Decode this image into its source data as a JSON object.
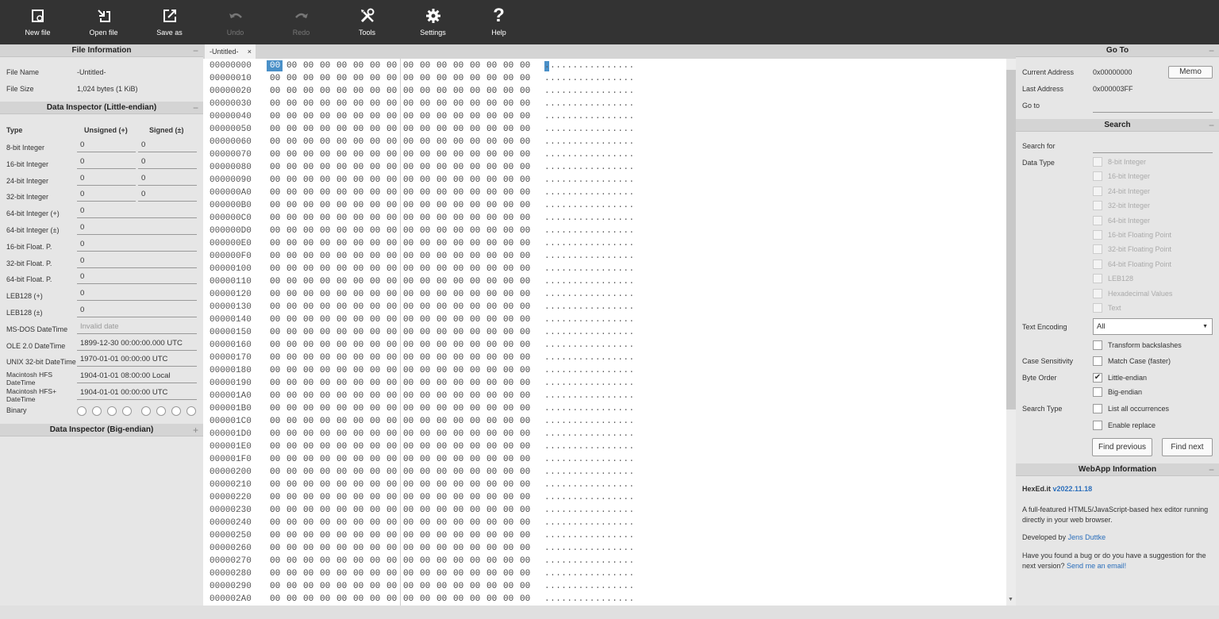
{
  "toolbar": {
    "new_file": "New file",
    "open_file": "Open file",
    "save_as": "Save as",
    "undo": "Undo",
    "redo": "Redo",
    "tools": "Tools",
    "settings": "Settings",
    "help": "Help"
  },
  "file_info": {
    "title": "File Information",
    "name_label": "File Name",
    "name_value": "-Untitled-",
    "size_label": "File Size",
    "size_value": "1,024 bytes (1 KiB)"
  },
  "inspector_le": {
    "title": "Data Inspector (Little-endian)",
    "col_type": "Type",
    "col_unsigned": "Unsigned (+)",
    "col_signed": "Signed (±)",
    "rows": [
      {
        "label": "8-bit Integer",
        "u": "0",
        "s": "0"
      },
      {
        "label": "16-bit Integer",
        "u": "0",
        "s": "0"
      },
      {
        "label": "24-bit Integer",
        "u": "0",
        "s": "0"
      },
      {
        "label": "32-bit Integer",
        "u": "0",
        "s": "0"
      }
    ],
    "wide_rows": [
      {
        "label": "64-bit Integer (+)",
        "v": "0"
      },
      {
        "label": "64-bit Integer (±)",
        "v": "0"
      },
      {
        "label": "16-bit Float. P.",
        "v": "0"
      },
      {
        "label": "32-bit Float. P.",
        "v": "0"
      },
      {
        "label": "64-bit Float. P.",
        "v": "0"
      },
      {
        "label": "LEB128 (+)",
        "v": "0"
      },
      {
        "label": "LEB128 (±)",
        "v": "0"
      },
      {
        "label": "MS-DOS DateTime",
        "v": "Invalid date"
      },
      {
        "label": "OLE 2.0 DateTime",
        "v": "1899-12-30 00:00:00.000 UTC"
      },
      {
        "label": "UNIX 32-bit DateTime",
        "v": "1970-01-01 00:00:00 UTC"
      },
      {
        "label": "Macintosh HFS DateTime",
        "v": "1904-01-01 08:00:00 Local"
      },
      {
        "label": "Macintosh HFS+ DateTime",
        "v": "1904-01-01 00:00:00 UTC"
      }
    ],
    "binary_label": "Binary"
  },
  "inspector_be": {
    "title": "Data Inspector (Big-endian)",
    "toggle": "+"
  },
  "tab": {
    "label": "-Untitled-",
    "close": "×"
  },
  "hex": {
    "addresses": [
      "00000000",
      "00000010",
      "00000020",
      "00000030",
      "00000040",
      "00000050",
      "00000060",
      "00000070",
      "00000080",
      "00000090",
      "000000A0",
      "000000B0",
      "000000C0",
      "000000D0",
      "000000E0",
      "000000F0",
      "00000100",
      "00000110",
      "00000120",
      "00000130",
      "00000140",
      "00000150",
      "00000160",
      "00000170",
      "00000180",
      "00000190",
      "000001A0",
      "000001B0",
      "000001C0",
      "000001D0",
      "000001E0",
      "000001F0",
      "00000200",
      "00000210",
      "00000220",
      "00000230",
      "00000240",
      "00000250",
      "00000260",
      "00000270",
      "00000280",
      "00000290",
      "000002A0"
    ],
    "byte": "00",
    "ascii": "................"
  },
  "goto": {
    "title": "Go To",
    "current_label": "Current Address",
    "current_value": "0x00000000",
    "memo": "Memo",
    "last_label": "Last Address",
    "last_value": "0x000003FF",
    "goto_label": "Go to"
  },
  "search": {
    "title": "Search",
    "search_for": "Search for",
    "data_type": "Data Type",
    "types": [
      "8-bit Integer",
      "16-bit Integer",
      "24-bit Integer",
      "32-bit Integer",
      "64-bit Integer",
      "16-bit Floating Point",
      "32-bit Floating Point",
      "64-bit Floating Point",
      "LEB128",
      "Hexadecimal Values",
      "Text"
    ],
    "text_encoding": "Text Encoding",
    "encoding_value": "All",
    "transform": "Transform backslashes",
    "case_label": "Case Sensitivity",
    "match_case": "Match Case (faster)",
    "byte_order": "Byte Order",
    "little": "Little-endian",
    "big": "Big-endian",
    "search_type": "Search Type",
    "list_all": "List all occurrences",
    "enable_replace": "Enable replace",
    "find_prev": "Find previous",
    "find_next": "Find next"
  },
  "webapp": {
    "title": "WebApp Information",
    "name": "HexEd.it",
    "version": "v2022.11.18",
    "desc": "A full-featured HTML5/JavaScript-based hex editor running directly in your web browser.",
    "dev_prefix": "Developed by",
    "dev_name": "Jens Duttke",
    "bug_text": "Have you found a bug or do you have a suggestion for the next version?",
    "bug_link": "Send me an email!"
  }
}
